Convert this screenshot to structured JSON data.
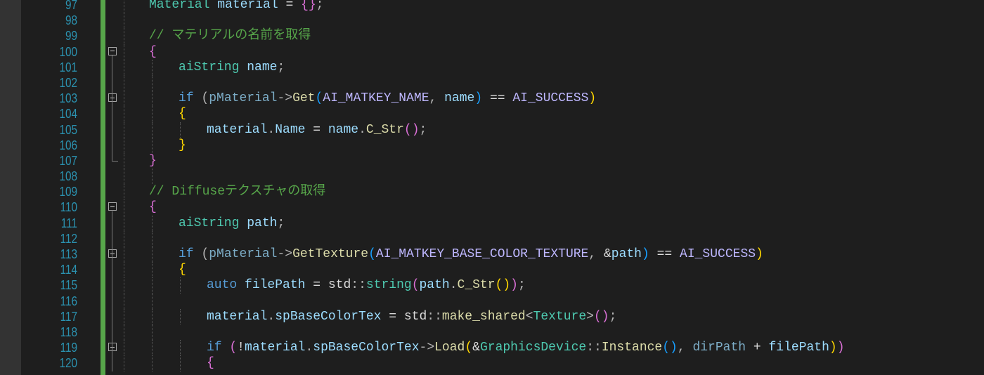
{
  "editor": {
    "lines": [
      {
        "num": "97",
        "indent": 0,
        "fold": false,
        "tokens": [
          [
            "ty",
            "Material"
          ],
          [
            "plain",
            " "
          ],
          [
            "var",
            "material"
          ],
          [
            "plain",
            " = "
          ],
          [
            "b1",
            "{}"
          ],
          [
            "op",
            ";"
          ]
        ]
      },
      {
        "num": "98",
        "indent": 0,
        "fold": false,
        "tokens": []
      },
      {
        "num": "99",
        "indent": 0,
        "fold": false,
        "tokens": [
          [
            "cm",
            "// マテリアルの名前を取得"
          ]
        ]
      },
      {
        "num": "100",
        "indent": 0,
        "fold": true,
        "tokens": [
          [
            "b1",
            "{"
          ]
        ]
      },
      {
        "num": "101",
        "indent": 1,
        "fold": false,
        "tokens": [
          [
            "ty",
            "aiString"
          ],
          [
            "plain",
            " "
          ],
          [
            "var",
            "name"
          ],
          [
            "op",
            ";"
          ]
        ]
      },
      {
        "num": "102",
        "indent": 0,
        "fold": false,
        "tokens": []
      },
      {
        "num": "103",
        "indent": 1,
        "fold": true,
        "tokens": [
          [
            "kw",
            "if"
          ],
          [
            "plain",
            " "
          ],
          [
            "op",
            "("
          ],
          [
            "p1",
            "pMaterial"
          ],
          [
            "op",
            "->"
          ],
          [
            "fn",
            "Get"
          ],
          [
            "b3",
            "("
          ],
          [
            "mac",
            "AI_MATKEY_NAME"
          ],
          [
            "op",
            ", "
          ],
          [
            "var",
            "name"
          ],
          [
            "b3",
            ")"
          ],
          [
            "plain",
            " == "
          ],
          [
            "mac",
            "AI_SUCCESS"
          ],
          [
            "b2",
            ")"
          ]
        ]
      },
      {
        "num": "104",
        "indent": 1,
        "fold": false,
        "tokens": [
          [
            "b2",
            "{"
          ]
        ]
      },
      {
        "num": "105",
        "indent": 2,
        "fold": false,
        "tokens": [
          [
            "var",
            "material"
          ],
          [
            "op",
            "."
          ],
          [
            "var",
            "Name"
          ],
          [
            "plain",
            " = "
          ],
          [
            "var",
            "name"
          ],
          [
            "op",
            "."
          ],
          [
            "fn",
            "C_Str"
          ],
          [
            "b1",
            "()"
          ],
          [
            "op",
            ";"
          ]
        ]
      },
      {
        "num": "106",
        "indent": 1,
        "fold": false,
        "tokens": [
          [
            "b2",
            "}"
          ]
        ]
      },
      {
        "num": "107",
        "indent": 0,
        "fold": false,
        "tokens": [
          [
            "b1",
            "}"
          ]
        ]
      },
      {
        "num": "108",
        "indent": 0,
        "fold": false,
        "tokens": []
      },
      {
        "num": "109",
        "indent": 0,
        "fold": false,
        "tokens": [
          [
            "cm",
            "// Diffuseテクスチャの取得"
          ]
        ]
      },
      {
        "num": "110",
        "indent": 0,
        "fold": true,
        "tokens": [
          [
            "b1",
            "{"
          ]
        ]
      },
      {
        "num": "111",
        "indent": 1,
        "fold": false,
        "tokens": [
          [
            "ty",
            "aiString"
          ],
          [
            "plain",
            " "
          ],
          [
            "var",
            "path"
          ],
          [
            "op",
            ";"
          ]
        ]
      },
      {
        "num": "112",
        "indent": 0,
        "fold": false,
        "tokens": []
      },
      {
        "num": "113",
        "indent": 1,
        "fold": true,
        "tokens": [
          [
            "kw",
            "if"
          ],
          [
            "plain",
            " "
          ],
          [
            "op",
            "("
          ],
          [
            "p1",
            "pMaterial"
          ],
          [
            "op",
            "->"
          ],
          [
            "fn",
            "GetTexture"
          ],
          [
            "b3",
            "("
          ],
          [
            "mac",
            "AI_MATKEY_BASE_COLOR_TEXTURE"
          ],
          [
            "op",
            ", "
          ],
          [
            "plain",
            "&"
          ],
          [
            "var",
            "path"
          ],
          [
            "b3",
            ")"
          ],
          [
            "plain",
            " == "
          ],
          [
            "mac",
            "AI_SUCCESS"
          ],
          [
            "b2",
            ")"
          ]
        ]
      },
      {
        "num": "114",
        "indent": 1,
        "fold": false,
        "tokens": [
          [
            "b2",
            "{"
          ]
        ]
      },
      {
        "num": "115",
        "indent": 2,
        "fold": false,
        "tokens": [
          [
            "kw",
            "auto"
          ],
          [
            "plain",
            " "
          ],
          [
            "var",
            "filePath"
          ],
          [
            "plain",
            " = "
          ],
          [
            "plain",
            "std"
          ],
          [
            "op",
            "::"
          ],
          [
            "ty",
            "string"
          ],
          [
            "b1",
            "("
          ],
          [
            "var",
            "path"
          ],
          [
            "op",
            "."
          ],
          [
            "fn",
            "C_Str"
          ],
          [
            "b2",
            "()"
          ],
          [
            "b1",
            ")"
          ],
          [
            "op",
            ";"
          ]
        ]
      },
      {
        "num": "116",
        "indent": 0,
        "fold": false,
        "tokens": []
      },
      {
        "num": "117",
        "indent": 2,
        "fold": false,
        "tokens": [
          [
            "var",
            "material"
          ],
          [
            "op",
            "."
          ],
          [
            "var",
            "spBaseColorTex"
          ],
          [
            "plain",
            " = "
          ],
          [
            "plain",
            "std"
          ],
          [
            "op",
            "::"
          ],
          [
            "fn",
            "make_shared"
          ],
          [
            "op",
            "<"
          ],
          [
            "ty",
            "Texture"
          ],
          [
            "op",
            ">"
          ],
          [
            "b1",
            "()"
          ],
          [
            "op",
            ";"
          ]
        ]
      },
      {
        "num": "118",
        "indent": 0,
        "fold": false,
        "tokens": []
      },
      {
        "num": "119",
        "indent": 2,
        "fold": true,
        "tokens": [
          [
            "kw",
            "if"
          ],
          [
            "plain",
            " "
          ],
          [
            "b1",
            "("
          ],
          [
            "plain",
            "!"
          ],
          [
            "var",
            "material"
          ],
          [
            "op",
            "."
          ],
          [
            "var",
            "spBaseColorTex"
          ],
          [
            "op",
            "->"
          ],
          [
            "fn",
            "Load"
          ],
          [
            "b2",
            "("
          ],
          [
            "plain",
            "&"
          ],
          [
            "ty",
            "GraphicsDevice"
          ],
          [
            "op",
            "::"
          ],
          [
            "fn",
            "Instance"
          ],
          [
            "b3",
            "()"
          ],
          [
            "op",
            ", "
          ],
          [
            "p1",
            "dirPath"
          ],
          [
            "plain",
            " + "
          ],
          [
            "var",
            "filePath"
          ],
          [
            "b2",
            ")"
          ],
          [
            "b1",
            ")"
          ]
        ]
      },
      {
        "num": "120",
        "indent": 2,
        "fold": false,
        "tokens": [
          [
            "b1",
            "{"
          ]
        ]
      }
    ]
  }
}
